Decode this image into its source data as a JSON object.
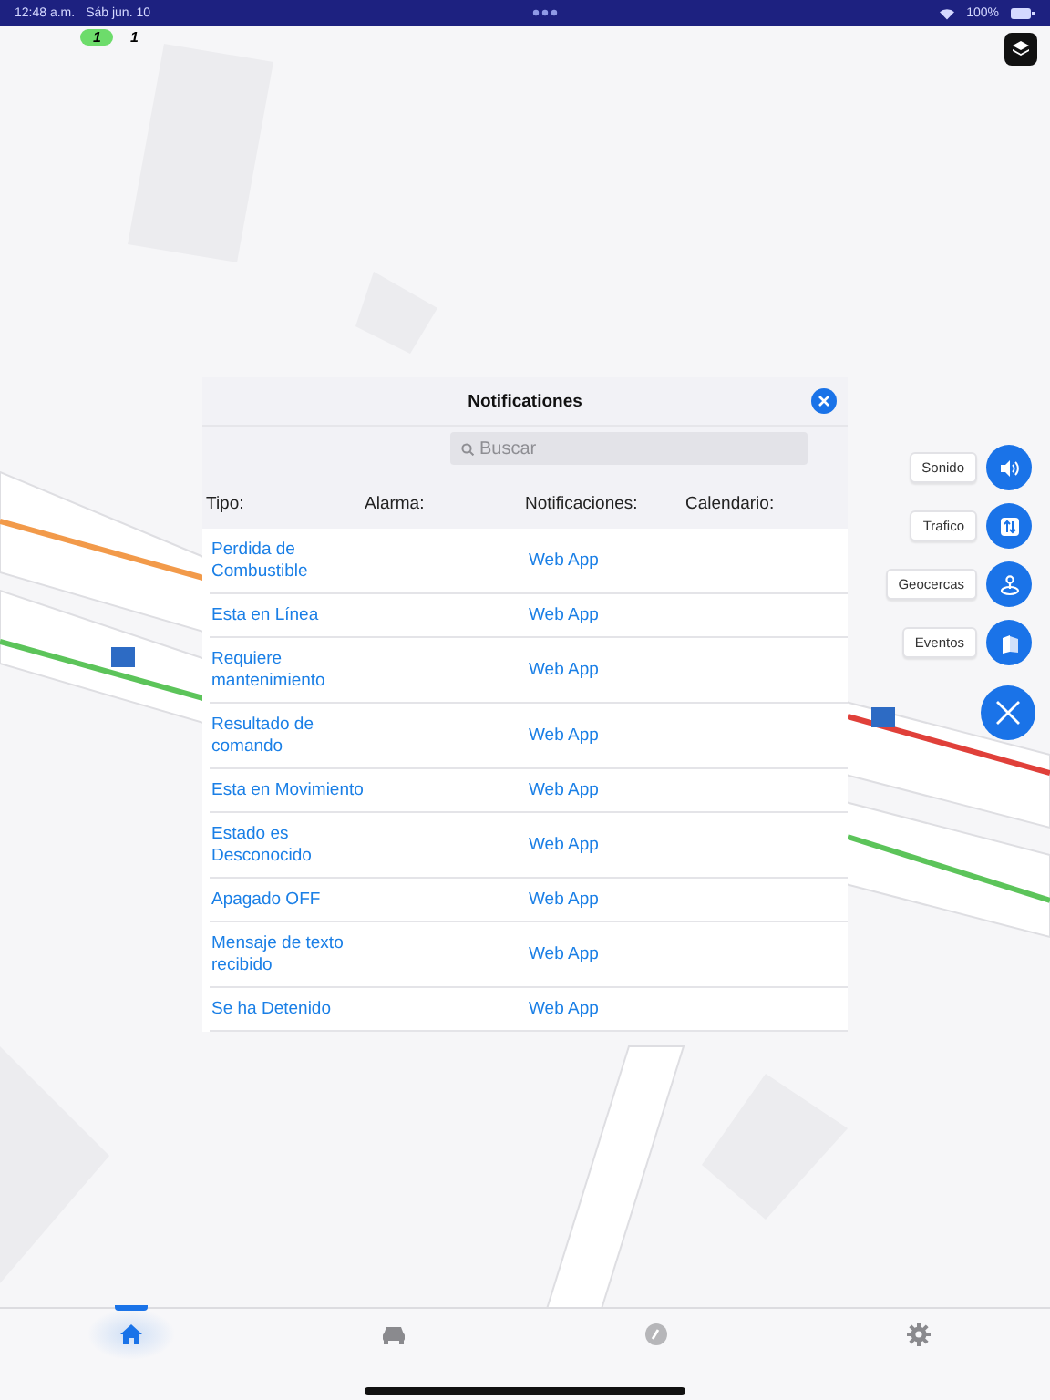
{
  "status_bar": {
    "time": "12:48 a.m.",
    "date": "Sáb jun. 10",
    "battery": "100%"
  },
  "badges": [
    {
      "kind": "pill",
      "text": "1"
    },
    {
      "kind": "plain",
      "text": "1"
    }
  ],
  "dialog": {
    "title": "Notificationes",
    "search": {
      "placeholder": "Buscar"
    },
    "columns": [
      "Tipo:",
      "Alarma:",
      "Notificaciones:",
      "Calendario:"
    ],
    "rows": [
      {
        "type": "Perdida de Combustible",
        "notification": "Web App"
      },
      {
        "type": "Esta en Línea",
        "notification": "Web App"
      },
      {
        "type": "Requiere mantenimiento",
        "notification": "Web App"
      },
      {
        "type": "Resultado de comando",
        "notification": "Web App"
      },
      {
        "type": "Esta en Movimiento",
        "notification": "Web App"
      },
      {
        "type": "Estado es Desconocido",
        "notification": "Web App"
      },
      {
        "type": "Apagado OFF",
        "notification": "Web App"
      },
      {
        "type": "Mensaje de texto recibido",
        "notification": "Web App"
      },
      {
        "type": "Se ha Detenido",
        "notification": "Web App"
      }
    ]
  },
  "actions": [
    {
      "kind": "sound",
      "label": "Sonido"
    },
    {
      "kind": "traffic",
      "label": "Trafico"
    },
    {
      "kind": "geofence",
      "label": "Geocercas"
    },
    {
      "kind": "events",
      "label": "Eventos"
    }
  ],
  "tabs": [
    {
      "kind": "home",
      "selected": true
    },
    {
      "kind": "car",
      "selected": false
    },
    {
      "kind": "compass",
      "selected": false
    },
    {
      "kind": "settings",
      "selected": false
    }
  ]
}
